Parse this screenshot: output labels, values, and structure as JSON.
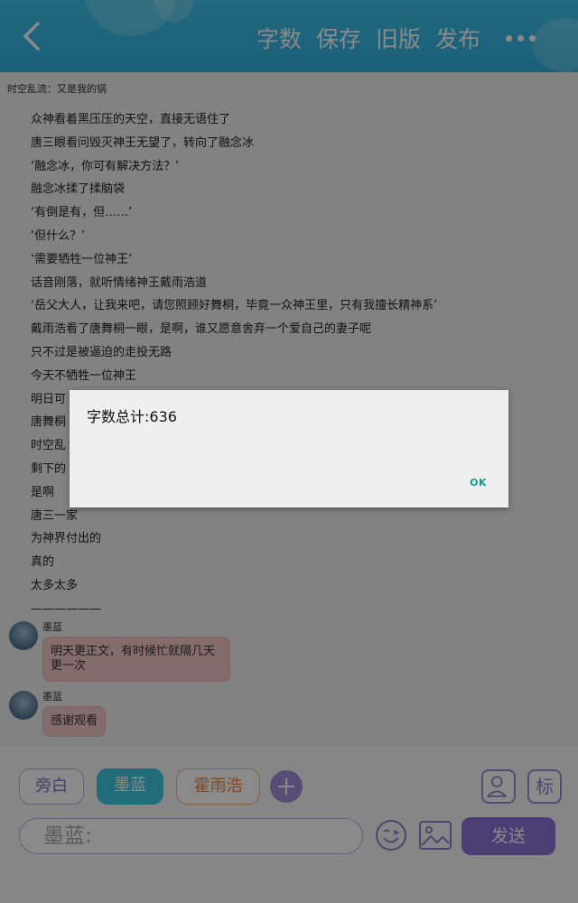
{
  "header": {
    "actions": [
      "字数",
      "保存",
      "旧版",
      "发布"
    ]
  },
  "chapter": {
    "title": "时空乱流：又是我的锅"
  },
  "story": {
    "lines": [
      "众神看着黑压压的天空，直接无语住了",
      "唐三眼看问毁灭神王无望了，转向了融念冰",
      "‘融念冰，你可有解决方法？’",
      "融念冰揉了揉脑袋",
      "‘有倒是有，但……’",
      "‘但什么？’",
      "‘需要牺牲一位神王’",
      "话音刚落，就听情绪神王戴雨浩道",
      "‘岳父大人，让我来吧，请您照顾好舞桐，毕竟一众神王里，只有我擅长精神系’",
      "戴雨浩看了唐舞桐一眼，是啊，谁又愿意舍弃一个爱自己的妻子呢",
      "只不过是被逼迫的走投无路",
      "今天不牺牲一位神王",
      "明日可",
      "唐舞桐",
      "时空乱",
      "剩下的",
      "是啊",
      "唐三一家",
      "为神界付出的",
      "真的",
      "太多太多",
      "——————"
    ]
  },
  "messages": [
    {
      "name": "墨蓝",
      "text": "明天更正文，有时候忙就隔几天更一次"
    },
    {
      "name": "墨蓝",
      "text": "感谢观看"
    }
  ],
  "characters": [
    "旁白",
    "墨蓝",
    "霍雨浩"
  ],
  "tag_button": "标",
  "composer": {
    "value": "墨蓝:",
    "send_label": "发送"
  },
  "dialog": {
    "message": "字数总计:636",
    "ok_label": "OK"
  },
  "colors": {
    "header": "#2fb0e0",
    "accent_purple": "#8a74d6",
    "accent_cyan": "#3ec7e0",
    "accent_orange": "#e5884a",
    "bubble_pink": "#f6c7c8",
    "dialog_ok": "#119a8f"
  },
  "icons": [
    "back-arrow-icon",
    "more-dots-icon",
    "plus-icon",
    "person-icon",
    "emoji-icon",
    "image-icon"
  ]
}
